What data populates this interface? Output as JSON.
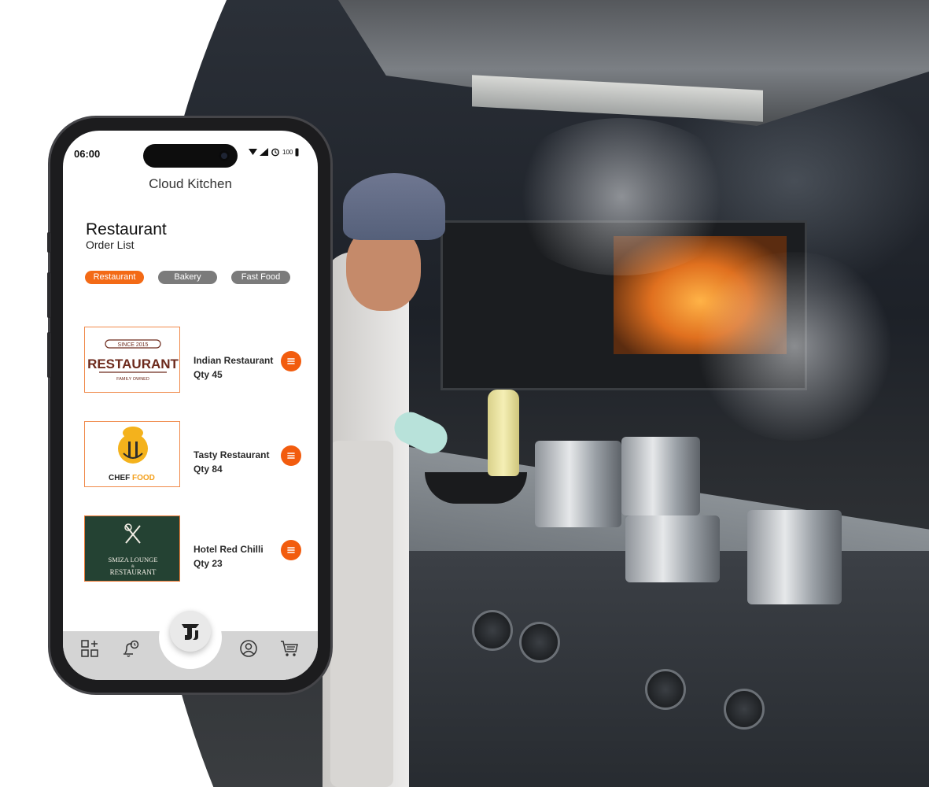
{
  "app": {
    "title": "Cloud Kitchen"
  },
  "status_bar": {
    "time": "06:00",
    "battery": "100"
  },
  "section": {
    "title": "Restaurant",
    "subtitle": "Order List"
  },
  "categories": [
    {
      "label": "Restaurant",
      "active": true
    },
    {
      "label": "Bakery",
      "active": false
    },
    {
      "label": "Fast Food",
      "active": false
    }
  ],
  "orders": [
    {
      "name": "Indian Restaurant",
      "qty": "Qty 45",
      "logo": {
        "top": "SINCE 2015",
        "main": "RESTAURANT",
        "bottom": "FAMILY OWNED"
      }
    },
    {
      "name": "Tasty Restaurant",
      "qty": "Qty 84",
      "logo": {
        "word1": "CHEF",
        "word2": "FOOD"
      }
    },
    {
      "name": "Hotel Red Chilli",
      "qty": "Qty 23",
      "logo": {
        "line1": "SMIZA LOUNGE",
        "line2": "&",
        "line3": "RESTAURANT"
      }
    }
  ],
  "tabbar": {
    "items": [
      "add-widget-icon",
      "alarm-bell-icon",
      "home-logo-icon",
      "profile-icon",
      "cart-icon"
    ]
  },
  "colors": {
    "accent": "#f36a16",
    "chip_inactive": "#7b7b7b",
    "logo_dark_bg": "#244233"
  }
}
